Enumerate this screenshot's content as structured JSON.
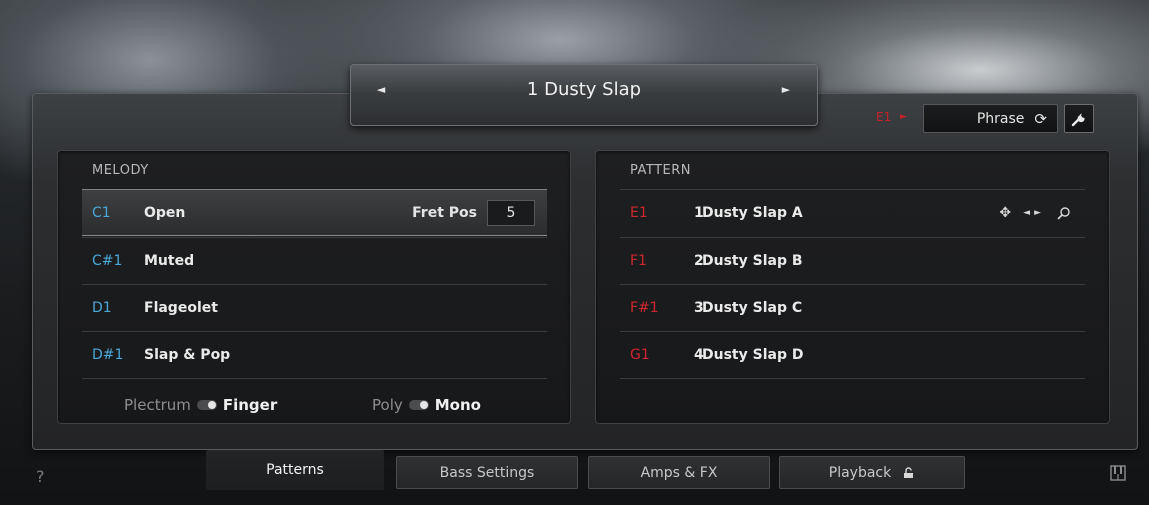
{
  "preset": {
    "prev_icon": "triangle-left-icon",
    "next_icon": "triangle-right-icon",
    "name": "1  Dusty Slap"
  },
  "header": {
    "trigger_key": "E1",
    "phrase_label": "Phrase",
    "phrase_icon": "sync-icon",
    "wrench_icon": "wrench-icon"
  },
  "melody": {
    "title": "MELODY",
    "rows": [
      {
        "key": "C1",
        "label": "Open"
      },
      {
        "key": "C#1",
        "label": "Muted"
      },
      {
        "key": "D1",
        "label": "Flageolet"
      },
      {
        "key": "D#1",
        "label": "Slap & Pop"
      }
    ],
    "fret_label": "Fret Pos",
    "fret_value": "5",
    "toggle1_off": "Plectrum",
    "toggle1_on": "Finger",
    "toggle2_off": "Poly",
    "toggle2_on": "Mono"
  },
  "pattern": {
    "title": "PATTERN",
    "rows": [
      {
        "key": "E1",
        "num": "1",
        "label": "Dusty Slap A"
      },
      {
        "key": "F1",
        "num": "2",
        "label": "Dusty Slap B"
      },
      {
        "key": "F#1",
        "num": "3",
        "label": "Dusty Slap C"
      },
      {
        "key": "G1",
        "num": "4",
        "label": "Dusty Slap D"
      }
    ]
  },
  "footer": {
    "help": "?",
    "tabs": [
      "Patterns",
      "Bass Settings",
      "Amps & FX",
      "Playback"
    ]
  },
  "colors": {
    "melody_key": "#4aa8d8",
    "pattern_key": "#d02630"
  }
}
